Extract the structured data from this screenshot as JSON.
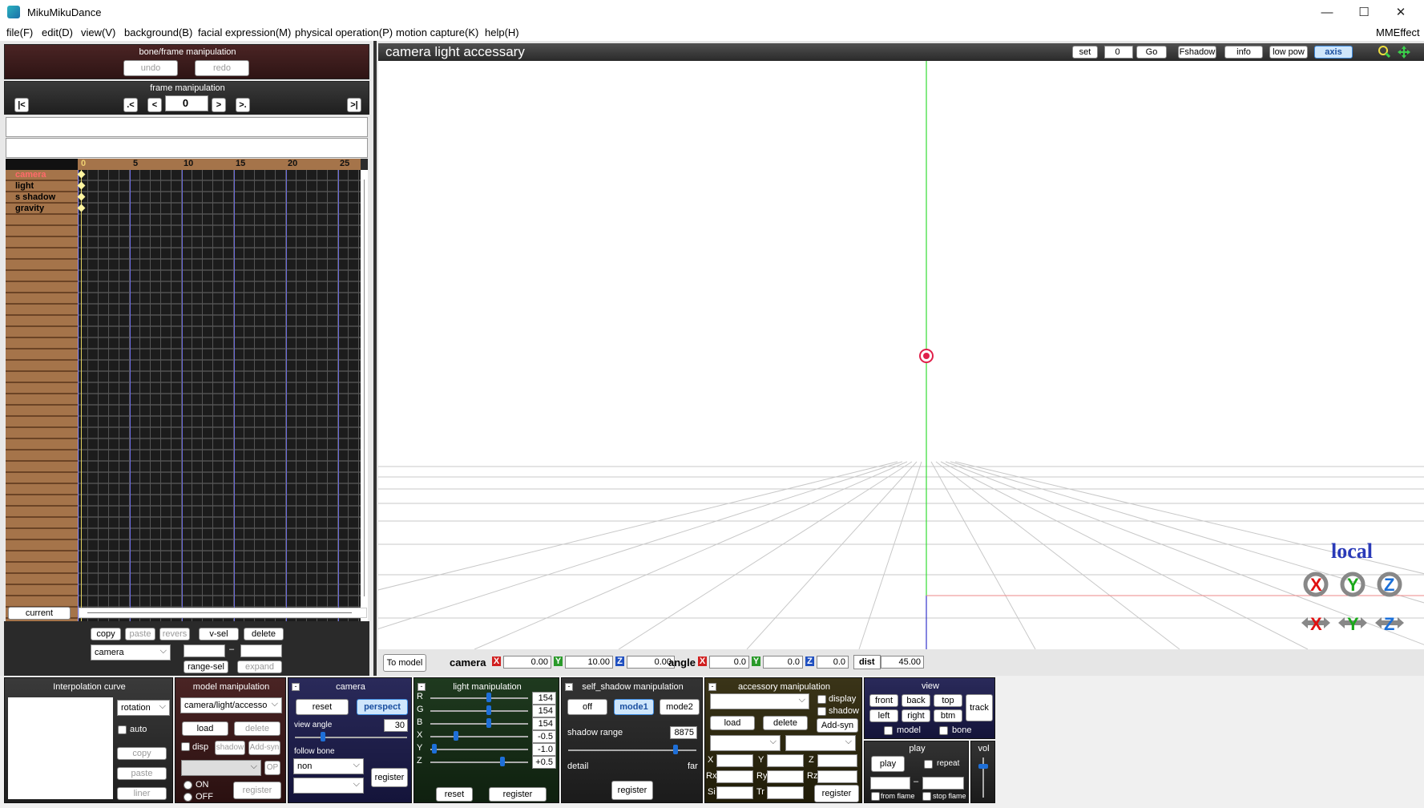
{
  "window": {
    "title": "MikuMikuDance",
    "controls": [
      "—",
      "☐",
      "✕"
    ]
  },
  "menu": [
    "file(F)",
    "edit(D)",
    "view(V)",
    "background(B)",
    "facial expression(M)",
    "physical operation(P)",
    "motion capture(K)",
    "help(H)"
  ],
  "menu_right": "MMEffect",
  "bone_frame": {
    "title": "bone/frame manipulation",
    "undo": "undo",
    "redo": "redo"
  },
  "frame_manip": {
    "title": "frame manipulation",
    "first": "|<",
    "prev_key": ".<",
    "prev": "<",
    "frame": "0",
    "next": ">",
    "next_key": ">.",
    "last": ">|"
  },
  "timeline": {
    "ticks": [
      "0",
      "5",
      "10",
      "15",
      "20",
      "25"
    ],
    "tracks": [
      "camera",
      "light",
      "s shadow",
      "gravity"
    ]
  },
  "timeline_bottom": {
    "current": "current",
    "copy": "copy",
    "paste": "paste",
    "revers": "revers",
    "vsel": "v-sel",
    "delete": "delete",
    "target": "camera",
    "range_sel": "range-sel",
    "expand": "expand",
    "dash": "–"
  },
  "viewport": {
    "title": "camera light accessary",
    "set": "set",
    "frame": "0",
    "go": "Go",
    "fshadow": "Fshadow",
    "info": "info",
    "lowpow": "low pow",
    "axis": "axis",
    "local": "local",
    "to_model": "To model"
  },
  "camera_bar": {
    "camera_label": "camera",
    "x": "0.00",
    "y": "10.00",
    "z": "0.00",
    "angle_label": "angle",
    "ax": "0.0",
    "ay": "0.0",
    "az": "0.0",
    "dist_label": "dist",
    "dist": "45.00",
    "X": "X",
    "Y": "Y",
    "Z": "Z"
  },
  "interp": {
    "title": "Interpolation curve",
    "mode": "rotation",
    "auto": "auto",
    "copy": "copy",
    "paste": "paste",
    "liner": "liner"
  },
  "model_manip": {
    "title": "model manipulation",
    "model": "camera/light/accesso",
    "load": "load",
    "delete": "delete",
    "disp": "disp",
    "shadow": "shadow",
    "addsyn": "Add-syn",
    "op": "OP",
    "on": "ON",
    "off": "OFF",
    "register": "register"
  },
  "camera_panel": {
    "title": "camera",
    "reset": "reset",
    "perspect": "perspect",
    "view_angle_label": "view angle",
    "view_angle": "30",
    "follow_bone": "follow bone",
    "bone": "non",
    "register": "register"
  },
  "light_panel": {
    "title": "light manipulation",
    "labels": [
      "R",
      "G",
      "B",
      "X",
      "Y",
      "Z"
    ],
    "values": [
      "154",
      "154",
      "154",
      "-0.5",
      "-1.0",
      "+0.5"
    ],
    "knobs": [
      0.6,
      0.6,
      0.6,
      0.25,
      0.02,
      0.75
    ],
    "reset": "reset",
    "register": "register"
  },
  "shadow_panel": {
    "title": "self_shadow manipulation",
    "off": "off",
    "mode1": "mode1",
    "mode2": "mode2",
    "range_label": "shadow range",
    "range": "8875",
    "knob": 0.85,
    "detail": "detail",
    "far": "far",
    "register": "register"
  },
  "acc_panel": {
    "title": "accessory manipulation",
    "display": "display",
    "shadow": "shadow",
    "load": "load",
    "delete": "delete",
    "addsyn": "Add-syn",
    "X": "X",
    "Y": "Y",
    "Z": "Z",
    "Rx": "Rx",
    "Ry": "Ry",
    "Rz": "Rz",
    "Si": "Si",
    "Tr": "Tr",
    "register": "register"
  },
  "view_panel": {
    "title": "view",
    "front": "front",
    "back": "back",
    "top": "top",
    "track": "track",
    "left": "left",
    "right": "right",
    "btm": "btm",
    "model": "model",
    "bone": "bone"
  },
  "play_panel": {
    "title": "play",
    "play": "play",
    "repeat": "repeat",
    "dash": "–",
    "from_flame": "from flame",
    "stop_flame": "stop flame"
  },
  "vol": {
    "title": "vol"
  },
  "colors": {
    "accent": "#1e6fd8",
    "track_bg": "#a5744a",
    "grid_bg": "#2c2c2c",
    "panel_dark": "#3d1c1c"
  }
}
